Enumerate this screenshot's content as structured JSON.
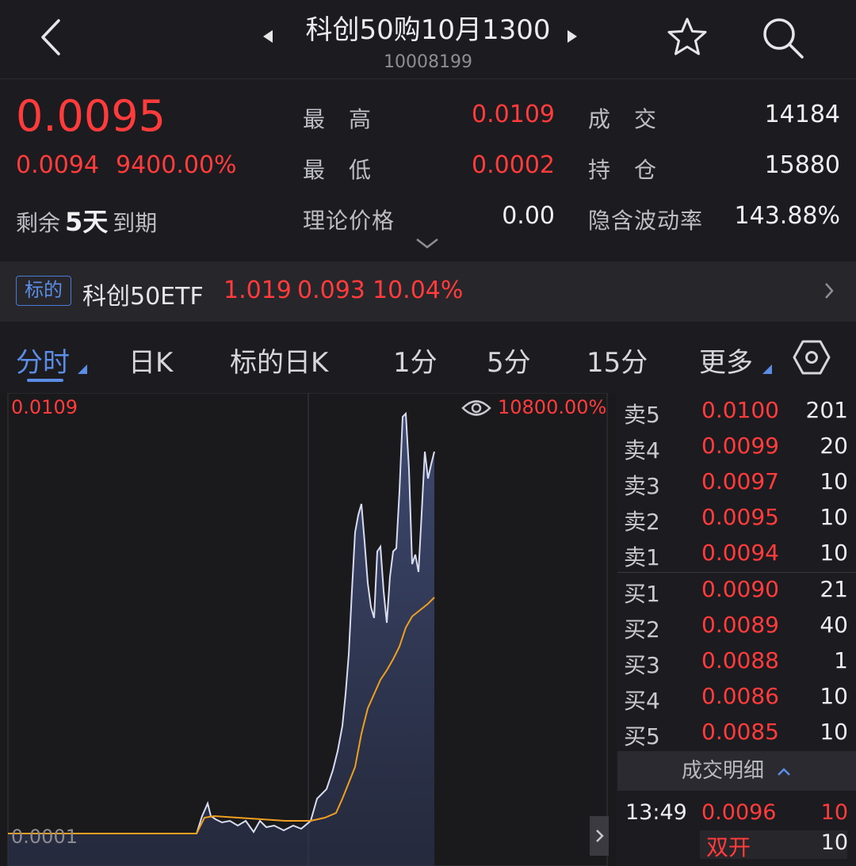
{
  "header": {
    "title": "科创50购10月1300",
    "code": "10008199"
  },
  "quote": {
    "last_price": "0.0095",
    "change_abs": "0.0094",
    "change_pct": "9400.00%",
    "remain_prefix": "剩余",
    "remain_days": "5天",
    "remain_suffix": "到期",
    "high_label": "最　高",
    "high_value": "0.0109",
    "low_label": "最　低",
    "low_value": "0.0002",
    "theory_label": "理论价格",
    "theory_value": "0.00",
    "volume_label": "成　交",
    "volume_value": "14184",
    "oi_label": "持　仓",
    "oi_value": "15880",
    "iv_label": "隐含波动率",
    "iv_value": "143.88%"
  },
  "underlying": {
    "tag": "标的",
    "name": "科创50ETF",
    "price": "1.019",
    "change": "0.093",
    "change_pct": "10.04%"
  },
  "tabs": [
    {
      "label": "分时",
      "active": true
    },
    {
      "label": "日K"
    },
    {
      "label": "标的日K"
    },
    {
      "label": "1分"
    },
    {
      "label": "5分"
    },
    {
      "label": "15分"
    },
    {
      "label": "更多"
    }
  ],
  "chart_labels": {
    "price_high": "0.0109",
    "pct_high": "10800.00%",
    "price_low": "0.0001"
  },
  "colors": {
    "up": "#ff3b3b",
    "accent": "#5b8de6",
    "price_line": "#d8dcf0",
    "avg_line": "#f0a020"
  },
  "order_book": {
    "asks": [
      {
        "side": "卖5",
        "price": "0.0100",
        "qty": "201"
      },
      {
        "side": "卖4",
        "price": "0.0099",
        "qty": "20"
      },
      {
        "side": "卖3",
        "price": "0.0097",
        "qty": "10"
      },
      {
        "side": "卖2",
        "price": "0.0095",
        "qty": "10"
      },
      {
        "side": "卖1",
        "price": "0.0094",
        "qty": "10"
      }
    ],
    "bids": [
      {
        "side": "买1",
        "price": "0.0090",
        "qty": "21"
      },
      {
        "side": "买2",
        "price": "0.0089",
        "qty": "40"
      },
      {
        "side": "买3",
        "price": "0.0088",
        "qty": "1"
      },
      {
        "side": "买4",
        "price": "0.0086",
        "qty": "10"
      },
      {
        "side": "买5",
        "price": "0.0085",
        "qty": "10"
      }
    ]
  },
  "trades": {
    "header": "成交明细",
    "time": "13:49",
    "price": "0.0096",
    "qty": "10",
    "type": "双开",
    "type_qty": "10"
  }
}
